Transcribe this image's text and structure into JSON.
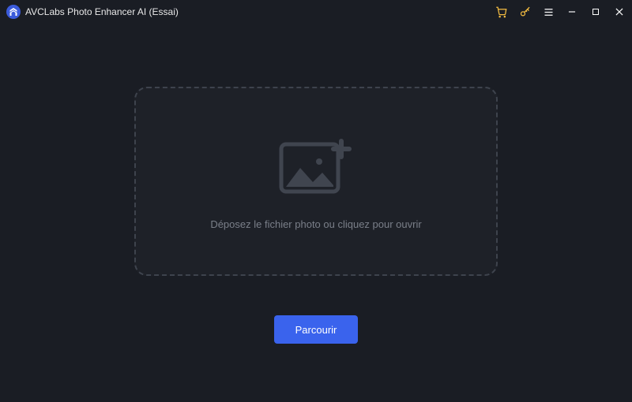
{
  "titlebar": {
    "app_title": "AVCLabs Photo Enhancer AI (Essai)"
  },
  "dropzone": {
    "hint": "Déposez le fichier photo ou cliquez pour ouvrir"
  },
  "actions": {
    "browse_label": "Parcourir"
  },
  "colors": {
    "accent": "#3a63ed",
    "gold": "#f5bd41",
    "background": "#1a1d24"
  }
}
